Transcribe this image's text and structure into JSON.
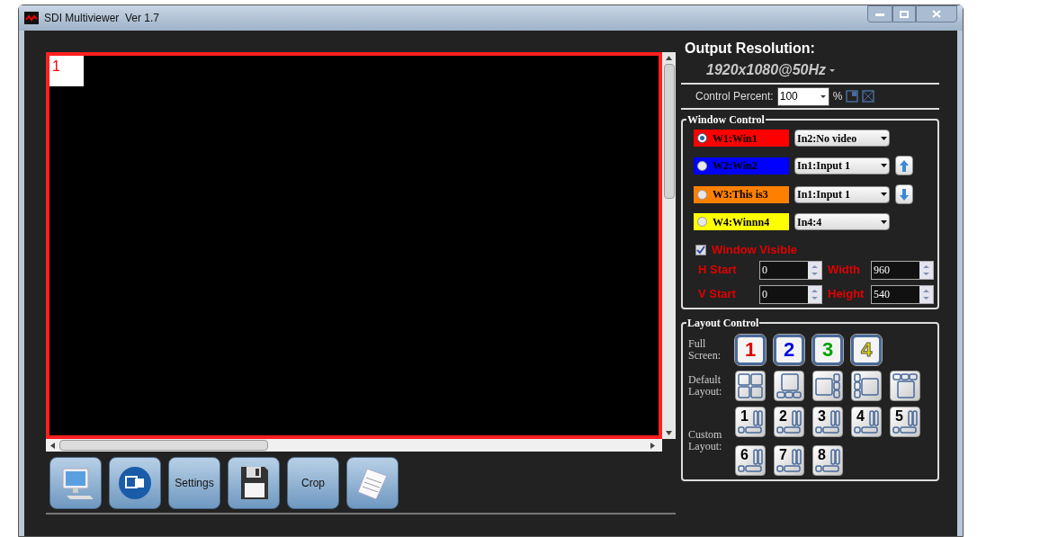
{
  "window": {
    "title": "SDI Multiviewer  Ver 1.7"
  },
  "canvas": {
    "window_label": "1"
  },
  "toolbar": [
    {
      "kind": "monitor"
    },
    {
      "kind": "connector"
    },
    {
      "kind": "text",
      "label": "Settings"
    },
    {
      "kind": "save"
    },
    {
      "kind": "text",
      "label": "Crop"
    },
    {
      "kind": "document"
    }
  ],
  "output": {
    "heading": "Output Resolution:",
    "resolution": "1920x1080@50Hz"
  },
  "control_percent": {
    "label": "Control Percent:",
    "value": "100",
    "unit": "%"
  },
  "window_control": {
    "title": "Window Control",
    "windows": [
      {
        "name": "W1:Win1",
        "color": "#ff0000",
        "selected": true,
        "input": "In2:No video",
        "kind": "plain"
      },
      {
        "name": "W2:Win2",
        "color": "#0000ff",
        "selected": false,
        "input": "In1:Input 1",
        "kind": "up"
      },
      {
        "name": "W3:This is3",
        "color": "#ff8000",
        "selected": false,
        "input": "In1:Input 1",
        "kind": "down"
      },
      {
        "name": "W4:Winnn4",
        "color": "#ffff00",
        "selected": false,
        "input": "In4:4",
        "kind": "plain"
      }
    ],
    "visible": {
      "label": "Window Visible",
      "checked": true
    },
    "fields": [
      {
        "label": "H Start",
        "value": "0"
      },
      {
        "label": "Width",
        "value": "960"
      },
      {
        "label": "V Start",
        "value": "0"
      },
      {
        "label": "Height",
        "value": "540"
      }
    ]
  },
  "layout_control": {
    "title": "Layout Control",
    "full_screen": {
      "label": "Full Screen:",
      "buttons": [
        "1",
        "2",
        "3",
        "4"
      ]
    },
    "default_layout": {
      "label": "Default Layout:",
      "buttons": [
        {
          "kind": "quad"
        },
        {
          "kind": "bottom-three"
        },
        {
          "kind": "right-three"
        },
        {
          "kind": "left-three"
        },
        {
          "kind": "top-three"
        }
      ]
    },
    "custom_layout": {
      "label": "Custom Layout:",
      "buttons": [
        "1",
        "2",
        "3",
        "4",
        "5",
        "6",
        "7",
        "8"
      ]
    }
  }
}
